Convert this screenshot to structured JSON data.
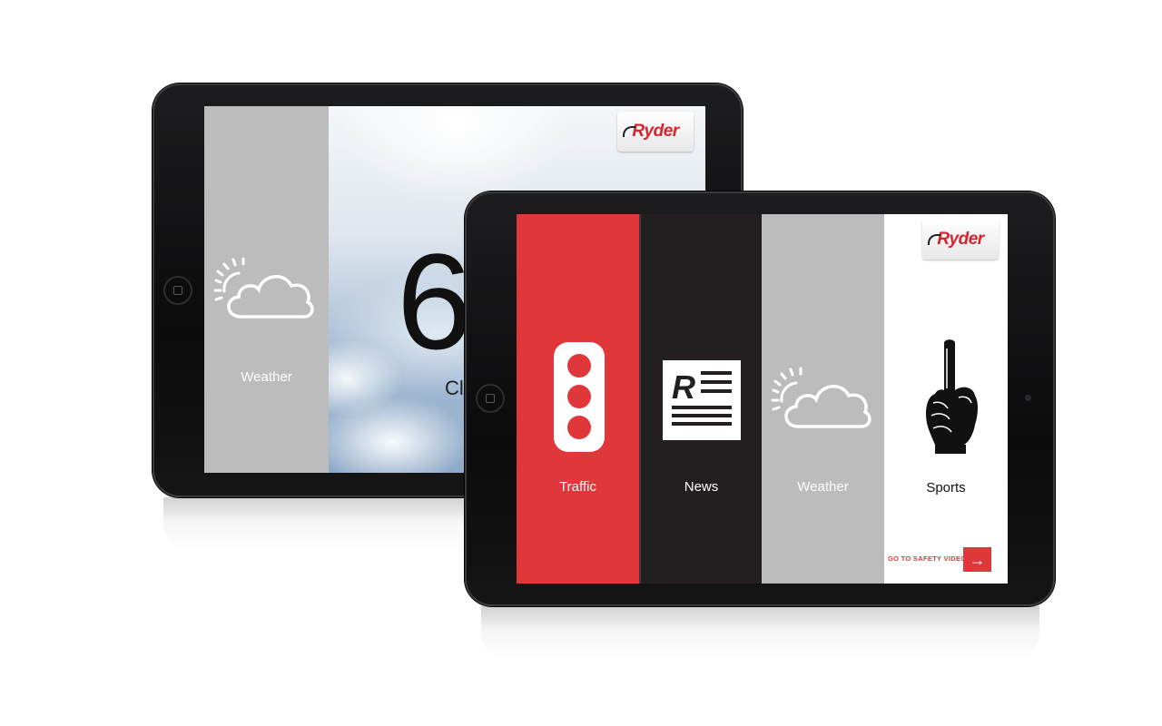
{
  "back_tablet": {
    "logo": "Ryder",
    "panel_label": "Weather",
    "temperature": "6",
    "condition": "Cl"
  },
  "front_tablet": {
    "logo": "Ryder",
    "panels": [
      {
        "label": "Traffic",
        "icon": "traffic-light-icon",
        "color": "#e0373b"
      },
      {
        "label": "News",
        "icon": "news-icon",
        "color": "#231f20"
      },
      {
        "label": "Weather",
        "icon": "weather-icon",
        "color": "#bcbcbc"
      },
      {
        "label": "Sports",
        "icon": "foam-finger-icon",
        "color": "#ffffff"
      }
    ],
    "safety_link": "GO TO SAFETY VIDEO",
    "safety_arrow": "→"
  },
  "colors": {
    "accent": "#e0373b",
    "bezel": "#111111"
  }
}
